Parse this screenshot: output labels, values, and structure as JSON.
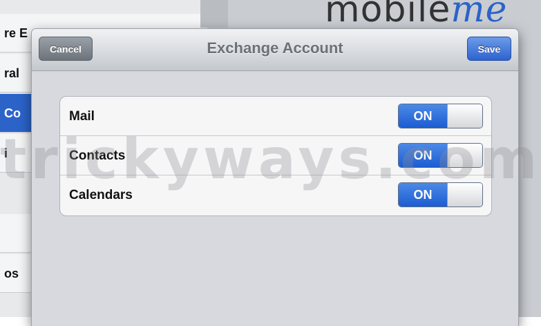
{
  "background": {
    "logo_left": "mobile",
    "logo_right": "me",
    "sidebar_rows": [
      "re E",
      "ral",
      "Co",
      "i",
      "",
      "",
      "os"
    ]
  },
  "dialog": {
    "title": "Exchange Account",
    "cancel_label": "Cancel",
    "save_label": "Save",
    "rows": [
      {
        "label": "Mail",
        "switch": "ON"
      },
      {
        "label": "Contacts",
        "switch": "ON"
      },
      {
        "label": "Calendars",
        "switch": "ON"
      }
    ]
  },
  "watermark": "trickyways.com",
  "colors": {
    "accent_blue": "#2b63c9",
    "switch_on": "#1c5dd2"
  }
}
